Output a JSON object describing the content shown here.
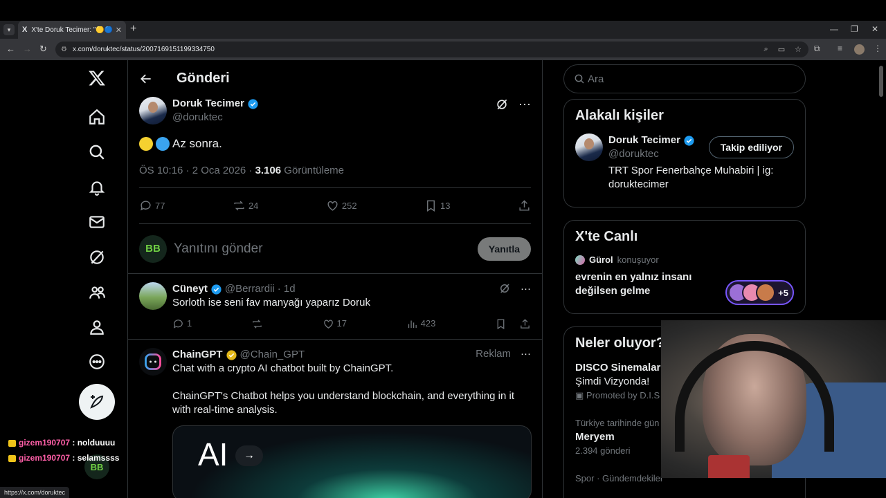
{
  "browser": {
    "tab_title": "X'te Doruk Tecimer: \"🟡🔵 Az ...",
    "tab_favicon": "X",
    "url": "x.com/doruktec/status/2007169151199334750",
    "status_url": "https://x.com/doruktec"
  },
  "nav": {
    "logo": "X",
    "items": [
      "home-icon",
      "search-icon",
      "bell-icon",
      "mail-icon",
      "grok-icon",
      "communities-icon",
      "profile-icon",
      "more-icon"
    ]
  },
  "chat": [
    {
      "user": "gizem190707",
      "msg": " : nolduuuu"
    },
    {
      "user": "gizem190707",
      "msg": " : selamssss"
    }
  ],
  "main": {
    "header_title": "Gönderi",
    "post": {
      "author_name": "Doruk Tecimer",
      "author_handle": "@doruktec",
      "text": "Az sonra.",
      "time": "ÖS 10:16 · 2 Oca 2026 · ",
      "views_count": "3.106",
      "views_label": " Görüntüleme",
      "replies": "77",
      "reposts": "24",
      "likes": "252",
      "bookmarks": "13"
    },
    "reply_placeholder": "Yanıtını gönder",
    "reply_button": "Yanıtla",
    "reply_avatar": "BB",
    "comment": {
      "name": "Cüneyt",
      "handle": "@Berrardii",
      "time": "· 1d",
      "text": "Sorloth ise seni fav manyağı yaparız Doruk",
      "replies": "1",
      "likes": "17",
      "views": "423"
    },
    "ad": {
      "name": "ChainGPT",
      "handle": "@Chain_GPT",
      "label": "Reklam",
      "line1": "Chat with a crypto AI chatbot built by ChainGPT.",
      "line2": "ChainGPT's Chatbot helps you understand blockchain, and everything in it with real-time analysis.",
      "card_text": "AI"
    }
  },
  "right": {
    "search_placeholder": "Ara",
    "people_title": "Alakalı kişiler",
    "person_name": "Doruk Tecimer",
    "person_handle": "@doruktec",
    "follow_label": "Takip ediliyor",
    "person_bio": "TRT Spor Fenerbahçe Muhabiri | ig: doruktecimer",
    "live_title": "X'te Canlı",
    "live_host": "Gürol",
    "live_status": "konuşuyor",
    "live_space": "evrenin en yalnız insanı değilsen gelme",
    "live_more": "+5",
    "trends_title": "Neler oluyor?",
    "trend1_title": "DISCO Sinemalar",
    "trend1_sub": "Şimdi Vizyonda!",
    "trend1_promo": "Promoted by D.I.S",
    "trend2_context": "Türkiye tarihinde gün",
    "trend2_title": "Meryem",
    "trend2_count": "2.394 gönderi",
    "trend3_context": "Spor · Gündemdekiler"
  },
  "colors": {
    "accent": "#1d9bf0",
    "gold": "#e2b719",
    "space_purple": "#7856ff"
  }
}
